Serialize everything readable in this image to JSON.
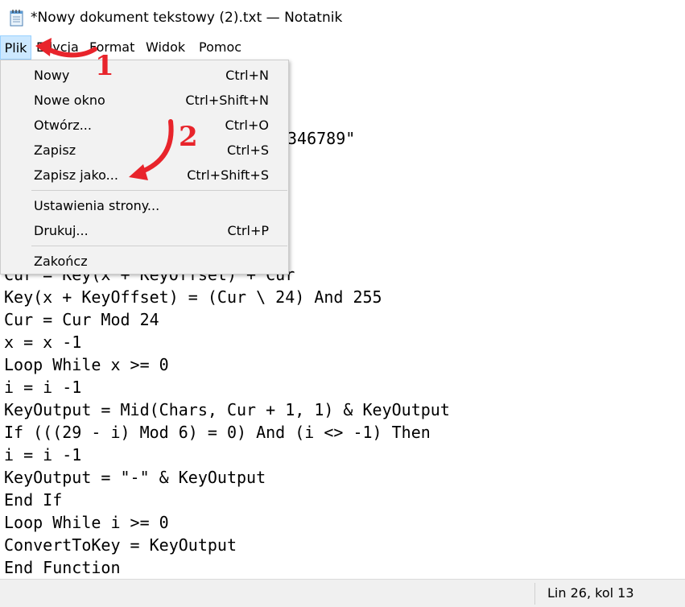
{
  "window": {
    "title": "*Nowy dokument tekstowy (2).txt — Notatnik",
    "icon": "notepad-icon"
  },
  "menubar": {
    "items": [
      {
        "label": "Plik",
        "active": true
      },
      {
        "label": "Edycja"
      },
      {
        "label": "Format"
      },
      {
        "label": "Widok"
      },
      {
        "label": "Pomoc"
      }
    ]
  },
  "editor": {
    "visible_fragment": "346789\"",
    "lines": [
      "Cur = Key(x + KeyOffset) + Cur",
      "Key(x + KeyOffset) = (Cur \\ 24) And 255",
      "Cur = Cur Mod 24",
      "x = x -1",
      "Loop While x >= 0",
      "i = i -1",
      "KeyOutput = Mid(Chars, Cur + 1, 1) & KeyOutput",
      "If (((29 - i) Mod 6) = 0) And (i <> -1) Then",
      "i = i -1",
      "KeyOutput = \"-\" & KeyOutput",
      "End If",
      "Loop While i >= 0",
      "ConvertToKey = KeyOutput",
      "End Function"
    ]
  },
  "file_menu": {
    "items": [
      {
        "label": "Nowy",
        "shortcut": "Ctrl+N"
      },
      {
        "label": "Nowe okno",
        "shortcut": "Ctrl+Shift+N"
      },
      {
        "label": "Otwórz...",
        "shortcut": "Ctrl+O"
      },
      {
        "label": "Zapisz",
        "shortcut": "Ctrl+S"
      },
      {
        "label": "Zapisz jako...",
        "shortcut": "Ctrl+Shift+S"
      },
      {
        "label": "Ustawienia strony...",
        "shortcut": ""
      },
      {
        "label": "Drukuj...",
        "shortcut": "Ctrl+P"
      },
      {
        "label": "Zakończ",
        "shortcut": ""
      }
    ]
  },
  "statusbar": {
    "position": "Lin 26, kol 13"
  },
  "annotations": {
    "step1": "1",
    "step2": "2",
    "color": "#e8242b"
  }
}
